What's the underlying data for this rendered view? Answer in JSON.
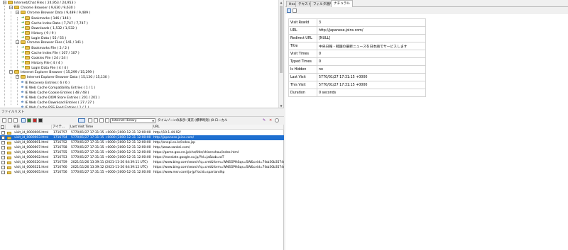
{
  "tree": {
    "items": [
      {
        "label": "Internet/Chat Files ( 24,953 / 24,953 )",
        "kind": "folder",
        "level": 0,
        "toggle": "−"
      },
      {
        "label": "Chrome Browser ( 9,630 / 9,630 )",
        "kind": "folder",
        "level": 1,
        "toggle": "−"
      },
      {
        "label": "Chrome Browser Data ( 9,489 / 9,489 )",
        "kind": "folder",
        "level": 2,
        "toggle": "−"
      },
      {
        "label": "Bookmarks ( 146 / 146 )",
        "kind": "arrow-folder",
        "level": 3,
        "toggle": ""
      },
      {
        "label": "Cache Index Data ( 7,747 / 7,747 )",
        "kind": "arrow-folder",
        "level": 3,
        "toggle": ""
      },
      {
        "label": "Downloads ( 1,532 / 1,532 )",
        "kind": "arrow-folder",
        "level": 3,
        "toggle": ""
      },
      {
        "label": "History ( 9 / 9 )",
        "kind": "arrow-folder",
        "level": 3,
        "toggle": ""
      },
      {
        "label": "Login Data ( 55 / 55 )",
        "kind": "arrow-folder",
        "level": 3,
        "toggle": ""
      },
      {
        "label": "Chrome Browser Files ( 141 / 141 )",
        "kind": "folder",
        "level": 2,
        "toggle": "−"
      },
      {
        "label": "Bookmarks File ( 2 / 2 )",
        "kind": "arrow-folder",
        "level": 3,
        "toggle": ""
      },
      {
        "label": "Cache Index File ( 107 / 107 )",
        "kind": "arrow-folder",
        "level": 3,
        "toggle": ""
      },
      {
        "label": "Cookies File ( 24 / 24 )",
        "kind": "arrow-folder",
        "level": 3,
        "toggle": ""
      },
      {
        "label": "History File ( 4 / 4 )",
        "kind": "arrow-folder",
        "level": 3,
        "toggle": ""
      },
      {
        "label": "Login Data File ( 4 / 4 )",
        "kind": "arrow-folder",
        "level": 3,
        "toggle": ""
      },
      {
        "label": "Internet Explorer Browser ( 15,299 / 15,299 )",
        "kind": "folder",
        "level": 1,
        "toggle": "−"
      },
      {
        "label": "Internet Explorer Browser Data ( 15,130 / 15,130 )",
        "kind": "folder",
        "level": 2,
        "toggle": "−"
      },
      {
        "label": "IE Recovery Entries ( 6 / 6 )",
        "kind": "ie",
        "level": 3,
        "toggle": ""
      },
      {
        "label": "IE Web Cache Compatibility Entries ( 1 / 1 )",
        "kind": "ie",
        "level": 3,
        "toggle": ""
      },
      {
        "label": "IE Web Cache Cookie Entries ( 48 / 48 )",
        "kind": "ie",
        "level": 3,
        "toggle": ""
      },
      {
        "label": "IE Web Cache DOM Store Entries ( 201 / 201 )",
        "kind": "ie",
        "level": 3,
        "toggle": ""
      },
      {
        "label": "IE Web Cache Download Entries ( 27 / 27 )",
        "kind": "ie",
        "level": 3,
        "toggle": ""
      },
      {
        "label": "IE Web Cache RSS Feed Entries ( 1 / 1 )",
        "kind": "ie",
        "level": 3,
        "toggle": ""
      }
    ]
  },
  "file_list": {
    "title": "ファイルリスト",
    "time_zone": {
      "selected": "Internet History",
      "label": "タイムゾーンの表示: 東京 (標準時刻)  (0-ローカル"
    },
    "columns": [
      "",
      "名前",
      "アイテ...",
      "Last Visit Time",
      "URL"
    ],
    "rows": [
      {
        "name": "visit_id_0000006.html",
        "item": "1716757",
        "time": "5770/01/27 17:31:15 +0000 (3000-12-31 12:00:00 UTC)",
        "url": "http://10.1.44.92/",
        "selected": false
      },
      {
        "name": "visit_id_0000003.html",
        "item": "1716754",
        "time": "5770/01/27 17:31:15 +0000 (3000-12-31 12:00:00 UTC)",
        "url": "http://japanese.joins.com/",
        "selected": true
      },
      {
        "name": "visit_id_0000001.html",
        "item": "1716752",
        "time": "5770/01/27 17:31:15 +0000 (3000-12-31 12:00:00 UTC)",
        "url": "http://onepi.co.kr/index.jsp",
        "selected": false
      },
      {
        "name": "visit_id_0000007.html",
        "item": "1716758",
        "time": "5770/01/27 17:31:15 +0000 (3000-12-31 12:00:00 UTC)",
        "url": "http://www.sankei.com/",
        "selected": false
      },
      {
        "name": "visit_id_0000004.html",
        "item": "1716755",
        "time": "5770/01/27 17:31:15 +0000 (3000-12-31 12:00:00 UTC)",
        "url": "https://game.goo.ne.jp/chs/title/shisenshou/index.html",
        "selected": false
      },
      {
        "name": "visit_id_0000002.html",
        "item": "1716753",
        "time": "5770/01/27 17:31:15 +0000 (3000-12-31 12:00:00 UTC)",
        "url": "https://translate.google.co.jp/?hl=ja&tab=wT",
        "selected": false
      },
      {
        "name": "visit_id_0006320.html",
        "item": "1716759",
        "time": "2021/11/26 13:39:11 (2021-11-26 04:39:11 UTC)",
        "url": "https://www.bing.com/search?q=cmt&form=WNSGPH&qs=SW&cvid=7fab30b3574c4e",
        "selected": false
      },
      {
        "name": "visit_id_0006321.html",
        "item": "1716760",
        "time": "2021/11/26 13:39:12 (2021-11-26 04:39:12 UTC)",
        "url": "https://www.bing.com/search?q=cmt&form=WNSGPH&qs=SW&cvid=7fab30b3574c4e",
        "selected": false
      },
      {
        "name": "visit_id_0000005.html",
        "item": "1716756",
        "time": "5770/01/27 17:31:15 +0000 (3000-12-31 12:00:00 UTC)",
        "url": "https://www.msn.com/ja-jp/?ocid=spartandhp",
        "selected": false
      }
    ]
  },
  "right_pane": {
    "tabs": [
      {
        "label": "Hex",
        "active": false
      },
      {
        "label": "テキスト",
        "active": false
      },
      {
        "label": "フィルタ適用",
        "active": false
      },
      {
        "label": "ナチュラル",
        "active": true
      }
    ],
    "properties": [
      {
        "key": "Visit RowId",
        "value": "3"
      },
      {
        "key": "URL",
        "value": "http://japanese.joins.com/"
      },
      {
        "key": "Redirect URL",
        "value": "[NULL]"
      },
      {
        "key": "Title",
        "value": "中央日報 - 韓国の最新ニュースを日本語でサービスします"
      },
      {
        "key": "Visit Times",
        "value": "0"
      },
      {
        "key": "Typed Times",
        "value": "0"
      },
      {
        "key": "Is Hidden",
        "value": "no"
      },
      {
        "key": "Last Visit",
        "value": "5770/01/27 17:31:15 +0000"
      },
      {
        "key": "This Visit",
        "value": "5770/01/27 17:31:15 +0000"
      },
      {
        "key": "Duration",
        "value": "0 seconds"
      }
    ]
  },
  "colors": {
    "selection": "#1e6fd0",
    "folder": "#e8c34a",
    "arrow": "#2a9a2a",
    "ie": "#1b5fb3"
  }
}
